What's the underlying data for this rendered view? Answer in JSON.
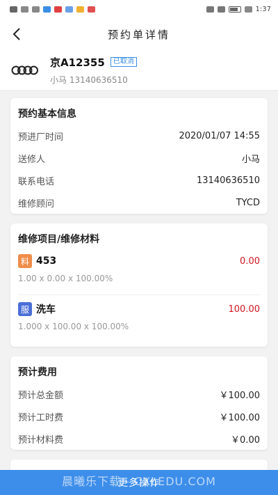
{
  "status_bar": {
    "time": "1:37"
  },
  "header": {
    "title": "预约单详情"
  },
  "car": {
    "plate": "京A12355",
    "status": "已取消",
    "owner": "小马 13140636510"
  },
  "basic": {
    "title": "预约基本信息",
    "rows": [
      {
        "label": "预进厂时间",
        "value": "2020/01/07 14:55"
      },
      {
        "label": "送修人",
        "value": "小马"
      },
      {
        "label": "联系电话",
        "value": "13140636510"
      },
      {
        "label": "维修顾问",
        "value": "TYCD"
      }
    ]
  },
  "items": {
    "title": "维修项目/维修材料",
    "list": [
      {
        "tag": "料",
        "tag_color": "#f08c4a",
        "name": "453",
        "price": "0.00",
        "formula": "1.00 x 0.00 x 100.00%"
      },
      {
        "tag": "服",
        "tag_color": "#4a6fd8",
        "name": "洗车",
        "price": "100.00",
        "formula": "1.000 x 100.00 x 100.00%"
      }
    ]
  },
  "fees": {
    "title": "预计费用",
    "rows": [
      {
        "label": "预计总金额",
        "value": "￥100.00"
      },
      {
        "label": "预计工时费",
        "value": "￥100.00"
      },
      {
        "label": "预计材料费",
        "value": "￥0.00"
      }
    ]
  },
  "bottom": {
    "more_label": "更多操作",
    "watermark": "晨曦乐下载 - CXLEDU.COM"
  }
}
